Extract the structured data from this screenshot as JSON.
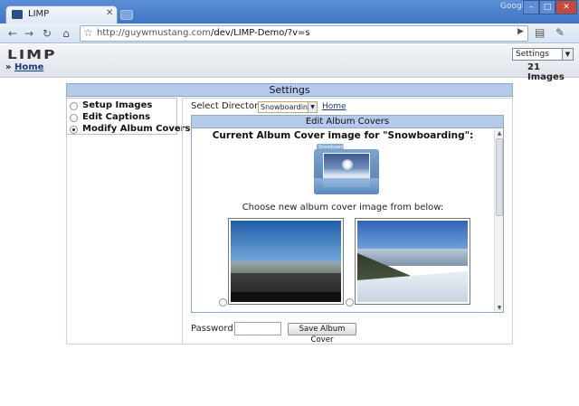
{
  "browser": {
    "tab_title": "LIMP",
    "brand": "Google",
    "url_host": "http://guywmustang.com",
    "url_path": "/dev/LIMP-Demo/?v=s",
    "min": "–",
    "max": "□",
    "close": "✕"
  },
  "header": {
    "logo": "LIMP",
    "nav_select_value": "Settings",
    "crumb": "Home",
    "image_count": "21 Images"
  },
  "settings": {
    "title": "Settings",
    "menu": [
      {
        "label": "Setup Images",
        "selected": false
      },
      {
        "label": "Edit Captions",
        "selected": false
      },
      {
        "label": "Modify Album Covers",
        "selected": true
      }
    ],
    "directory_label": "Select Directory:",
    "directory_value": "Snowboarding",
    "home_link": "Home",
    "panel_title": "Edit Album Covers",
    "current_heading": "Current Album Cover image for \"Snowboarding\":",
    "folder_tab": "Snowboarding",
    "choose_text": "Choose new album cover image from below:",
    "password_label": "Password:",
    "save_button": "Save Album Cover"
  },
  "colors": {
    "panel_header": "#b5c9e8",
    "link": "#1a3a7a"
  }
}
